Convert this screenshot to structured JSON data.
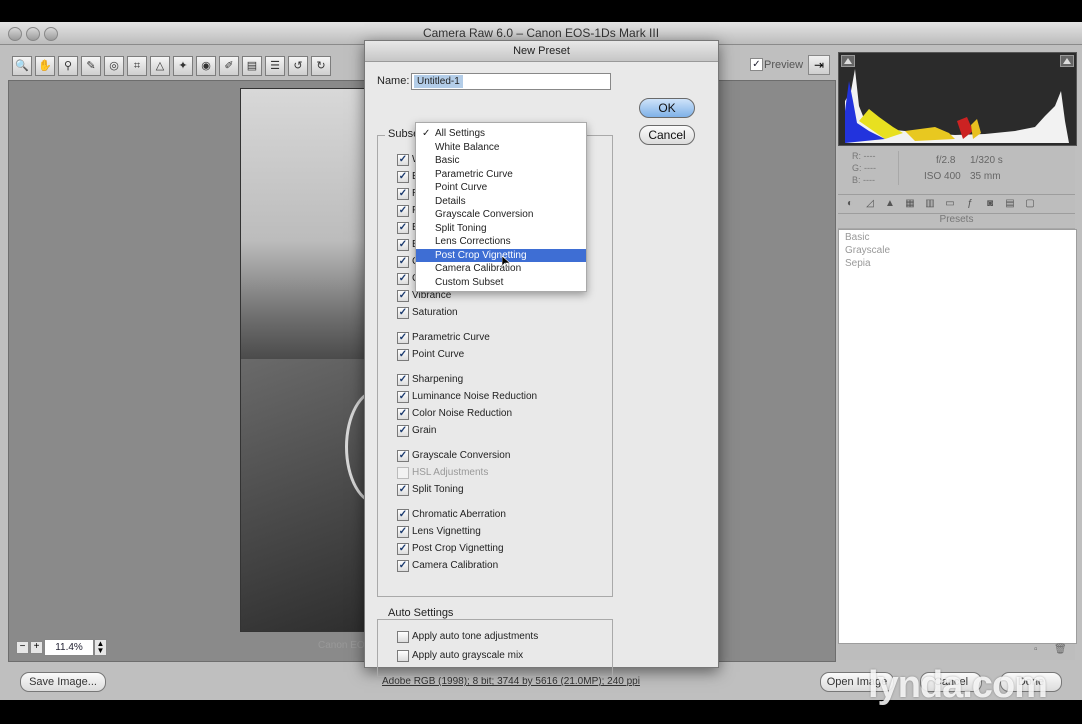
{
  "window": {
    "title": "Camera Raw 6.0  –  Canon EOS-1Ds Mark III"
  },
  "toolbar": {
    "tools": [
      "zoom-icon",
      "hand-icon",
      "white-balance-icon",
      "color-sampler-icon",
      "target-adjust-icon",
      "crop-icon",
      "straighten-icon",
      "spot-removal-icon",
      "red-eye-icon",
      "adjustment-brush-icon",
      "graduated-filter-icon",
      "preferences-icon",
      "rotate-ccw-icon",
      "rotate-cw-icon"
    ],
    "preview_label": "Preview",
    "preview_checked": true
  },
  "canvas": {
    "zoom_value": "11.4%",
    "under_filename": "Canon EO"
  },
  "histogram": {
    "readout": {
      "r": "R:  ----",
      "g": "G:  ----",
      "b": "B:  ----"
    },
    "camera": {
      "aperture": "f/2.8",
      "shutter": "1/320 s",
      "iso": "ISO 400",
      "focal": "35 mm"
    }
  },
  "panel": {
    "tabs": [
      "basic-icon",
      "tone-curve-icon",
      "detail-icon",
      "hsl-icon",
      "split-toning-icon",
      "lens-icon",
      "fx-icon",
      "camera-calibration-icon",
      "presets-icon",
      "snapshots-icon"
    ],
    "presets_title": "Presets",
    "presets": [
      "Basic",
      "Grayscale",
      "Sepia"
    ]
  },
  "bottom": {
    "save_label": "Save Image...",
    "status": "Adobe RGB (1998); 8 bit; 3744 by 5616 (21.0MP); 240 ppi",
    "open_label": "Open Image",
    "cancel_label": "Cancel",
    "done_label": "Done"
  },
  "watermark": "lynda.com",
  "dialog": {
    "title": "New Preset",
    "name_label": "Name:",
    "name_value": "Untitled-1",
    "ok_label": "OK",
    "cancel_label": "Cancel",
    "subset_label": "Subset",
    "settings": [
      {
        "label": "White Balance",
        "checked": true,
        "enabled": true
      },
      {
        "label": "Exposure",
        "checked": true,
        "enabled": true
      },
      {
        "label": "Recovery",
        "checked": true,
        "enabled": true
      },
      {
        "label": "Fill Light",
        "checked": true,
        "enabled": true
      },
      {
        "label": "Blacks",
        "checked": true,
        "enabled": true
      },
      {
        "label": "Brightness",
        "checked": true,
        "enabled": true
      },
      {
        "label": "Contrast",
        "checked": true,
        "enabled": true
      },
      {
        "label": "Clarity",
        "checked": true,
        "enabled": true
      },
      {
        "label": "Vibrance",
        "checked": true,
        "enabled": true
      },
      {
        "label": "Saturation",
        "checked": true,
        "enabled": true
      },
      {
        "label": "Parametric Curve",
        "checked": true,
        "enabled": true
      },
      {
        "label": "Point Curve",
        "checked": true,
        "enabled": true
      },
      {
        "label": "Sharpening",
        "checked": true,
        "enabled": true
      },
      {
        "label": "Luminance Noise Reduction",
        "checked": true,
        "enabled": true
      },
      {
        "label": "Color Noise Reduction",
        "checked": true,
        "enabled": true
      },
      {
        "label": "Grain",
        "checked": true,
        "enabled": true
      },
      {
        "label": "Grayscale Conversion",
        "checked": true,
        "enabled": true
      },
      {
        "label": "HSL Adjustments",
        "checked": false,
        "enabled": false
      },
      {
        "label": "Split Toning",
        "checked": true,
        "enabled": true
      },
      {
        "label": "Chromatic Aberration",
        "checked": true,
        "enabled": true
      },
      {
        "label": "Lens Vignetting",
        "checked": true,
        "enabled": true
      },
      {
        "label": "Post Crop Vignetting",
        "checked": true,
        "enabled": true
      },
      {
        "label": "Camera Calibration",
        "checked": true,
        "enabled": true
      }
    ],
    "auto_title": "Auto Settings",
    "auto": [
      {
        "label": "Apply auto tone adjustments",
        "checked": false
      },
      {
        "label": "Apply auto grayscale mix",
        "checked": false
      }
    ],
    "menu": [
      {
        "label": "All Settings",
        "checked": true
      },
      {
        "label": "White Balance"
      },
      {
        "label": "Basic"
      },
      {
        "label": "Parametric Curve"
      },
      {
        "label": "Point Curve"
      },
      {
        "label": "Details"
      },
      {
        "label": "Grayscale Conversion"
      },
      {
        "label": "Split Toning"
      },
      {
        "label": "Lens Corrections"
      },
      {
        "label": "Post Crop Vignetting",
        "highlighted": true
      },
      {
        "label": "Camera Calibration"
      },
      {
        "label": "Custom Subset"
      }
    ]
  }
}
